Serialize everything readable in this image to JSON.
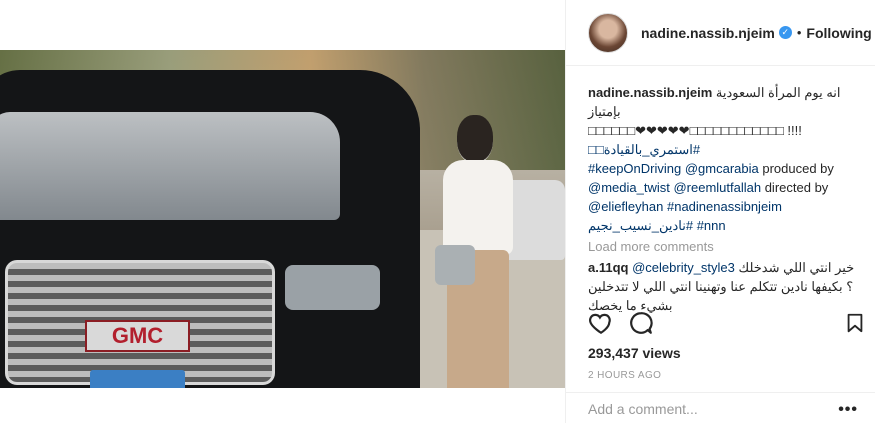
{
  "post": {
    "author": {
      "username": "nadine.nassib.njeim",
      "verified": true,
      "follow_status": "Following",
      "separator": "•"
    },
    "caption": {
      "username": "nadine.nassib.njeim",
      "arabic_text": "انه يوم المرأة السعودية بإمتياز",
      "glyph_line": "□□□□□□❤❤❤❤❤□□□□□□□□□□□□ !!!!",
      "hashtag_1": "#استمري_بالقيادة□□",
      "hashtag_2": "#keepOnDriving",
      "mention_1": "@gmcarabia",
      "text_produced_by": " produced by",
      "mention_2": "@media_twist",
      "mention_3": "@reemlutfallah",
      "text_directed_by": " directed by",
      "mention_4": "@eliefleyhan",
      "hashtag_3": "#nadinenassibnjeim",
      "hashtag_4": "#نادين_نسيب_نجيم",
      "hashtag_5": "#nnn"
    },
    "load_more": "Load more comments",
    "comment": {
      "username": "a.11qq",
      "mention": "@celebrity_style3",
      "text": "خير انتي اللي شدخلك ؟ بكيفها نادين تتكلم عنا وتهنينا انتي اللي لا تتدخلين بشيء ما يخصك"
    },
    "views": "293,437 views",
    "time_ago": "2 HOURS AGO",
    "add_comment_placeholder": "Add a comment...",
    "more_options": "•••"
  },
  "video": {
    "badge_text": "GMC"
  },
  "icons": {
    "like": "heart-icon",
    "comment": "comment-bubble-icon",
    "save": "bookmark-icon",
    "verified": "verified-badge-icon"
  },
  "colors": {
    "link": "#003569",
    "verified": "#3897f0",
    "muted": "#999999",
    "border": "#efefef"
  }
}
